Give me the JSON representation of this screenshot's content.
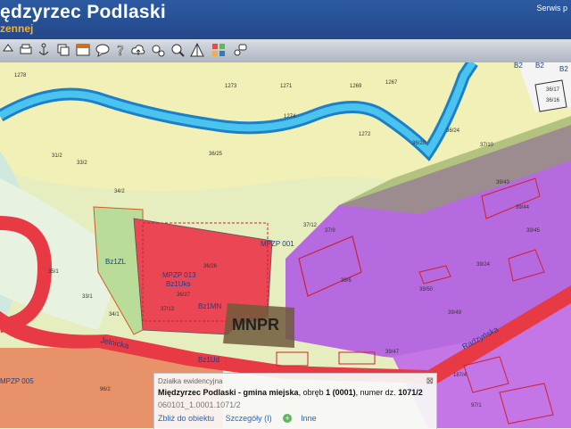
{
  "header": {
    "title": "ędzyrzec Podlaski",
    "subtitle": "zennej",
    "service": "Serwis p"
  },
  "toolbar": {
    "tools": [
      "pan-icon",
      "print-icon",
      "anchor-icon",
      "layers-icon",
      "legend-icon",
      "chat-icon",
      "help-icon",
      "cloud-upload-icon",
      "settings-icon",
      "zoom-icon",
      "measure-icon",
      "colors-icon",
      "info-icon"
    ]
  },
  "map": {
    "big_label": "MNPR",
    "zones": [
      "MPZP 013",
      "Bz1Uks",
      "Bz1ZL",
      "Bz1MN",
      "Bz1Ud",
      "MPZP 001",
      "MPZP 005",
      "B2",
      "B2",
      "B2"
    ],
    "roads": [
      "Jelnicka",
      "Radzyńska"
    ],
    "parcels": [
      "1278",
      "1273",
      "1271",
      "1269",
      "1267",
      "1274",
      "1272",
      "36/24",
      "36/20",
      "36/25",
      "37/10",
      "31/2",
      "33/2",
      "34/2",
      "36/26",
      "36/27",
      "37/13",
      "37/12",
      "39/6",
      "39/43",
      "39/44",
      "39/45",
      "39/24",
      "39/50",
      "39/49",
      "39/47",
      "33/1",
      "34/1",
      "35/1",
      "96/2",
      "187/4",
      "97/1",
      "37/9",
      "36/17",
      "36/16"
    ]
  },
  "popup": {
    "header": "Działka ewidencyjna",
    "name": "Międzyrzec Podlaski - gmina miejska",
    "obreb_label": ", obręb",
    "obreb_value": "1 (0001)",
    "numer_label": ", numer dz.",
    "numer_value": "1071/2",
    "id": "060101_1.0001.1071/2",
    "link_zoom": "Zbliż do obiektu",
    "link_details": "Szczegóły (I)",
    "link_other": "Inne",
    "close": "⊠"
  }
}
